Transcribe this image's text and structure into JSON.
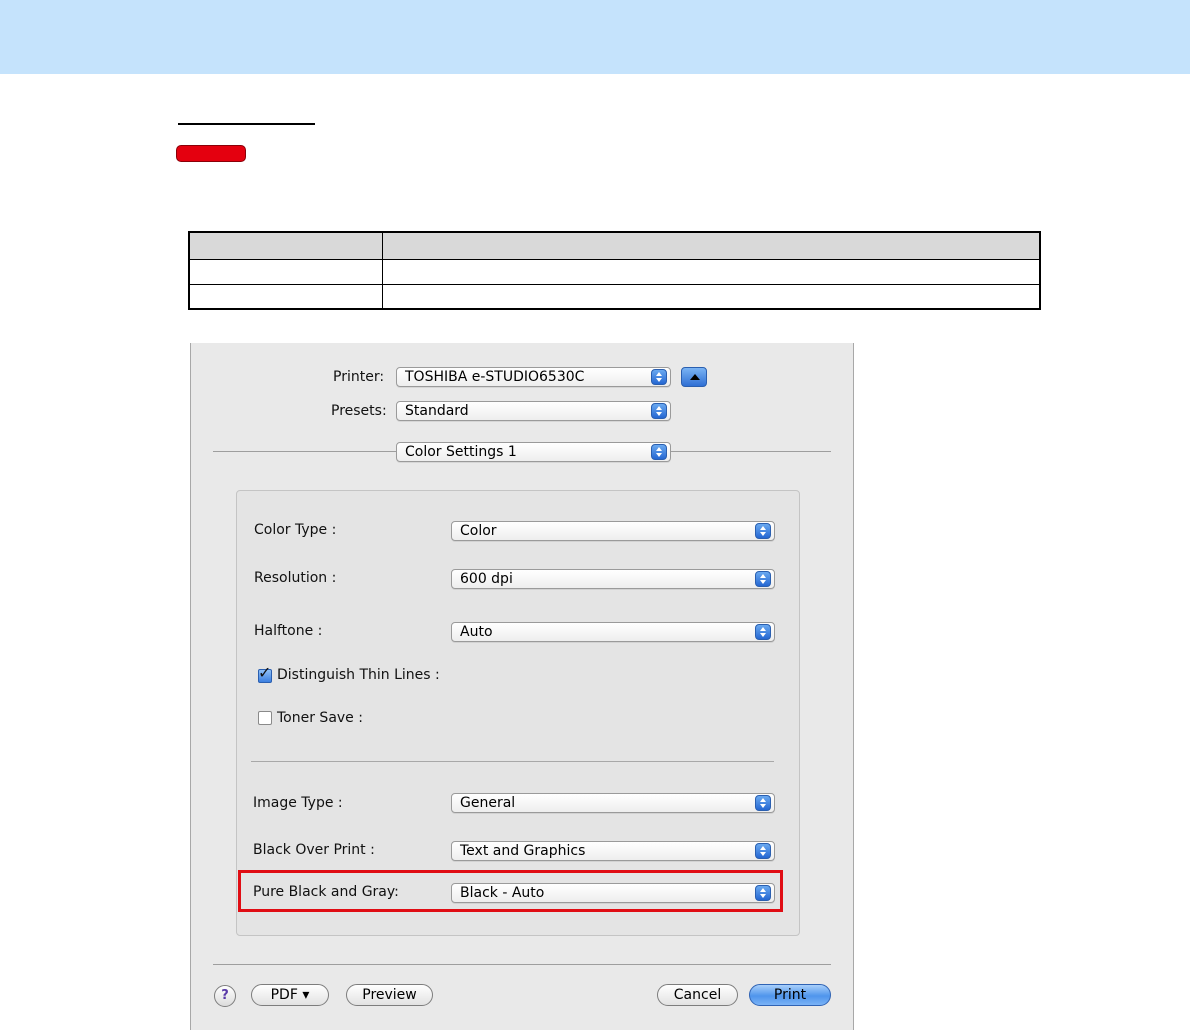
{
  "print_dialog": {
    "printer_label": "Printer:",
    "printer_value": "TOSHIBA e-STUDIO6530C",
    "presets_label": "Presets:",
    "presets_value": "Standard",
    "pane_value": "Color Settings 1",
    "fields": {
      "color_type_label": "Color Type :",
      "color_type_value": "Color",
      "resolution_label": "Resolution :",
      "resolution_value": "600 dpi",
      "halftone_label": "Halftone :",
      "halftone_value": "Auto",
      "thin_lines_label": "Distinguish Thin Lines :",
      "thin_lines_checked": true,
      "toner_save_label": "Toner Save :",
      "toner_save_checked": false,
      "image_type_label": "Image Type :",
      "image_type_value": "General",
      "black_over_print_label": "Black Over Print :",
      "black_over_print_value": "Text and Graphics",
      "pure_black_gray_label": "Pure Black and Gray:",
      "pure_black_gray_value": "Black - Auto"
    },
    "buttons": {
      "help": "?",
      "pdf": "PDF ▾",
      "preview": "Preview",
      "cancel": "Cancel",
      "print": "Print"
    }
  },
  "colors": {
    "banner": "#c5e3fc",
    "tag": "#e4000f",
    "highlight": "#e00d14",
    "table_header": "#d9d9d9"
  }
}
